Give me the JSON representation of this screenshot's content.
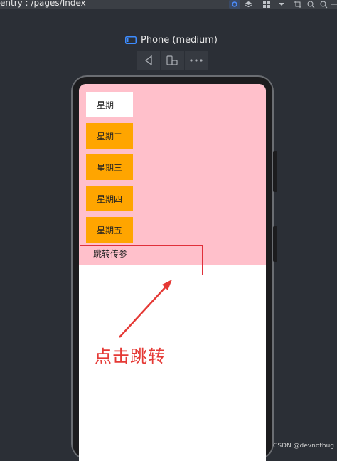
{
  "toolbar": {
    "breadcrumb": "entry : /pages/Index"
  },
  "device": {
    "name": "Phone (medium)"
  },
  "app": {
    "days": [
      "星期一",
      "星期二",
      "星期三",
      "星期四",
      "星期五"
    ],
    "jump_label": "跳转传参"
  },
  "annotation": {
    "label": "点击跳转"
  },
  "watermark": "CSDN @devnotbug",
  "colors": {
    "pink_background": "#ffc0cb",
    "selected_day": "#ffffff",
    "day_button": "#ffa500",
    "annotation_red": "#e53935"
  }
}
